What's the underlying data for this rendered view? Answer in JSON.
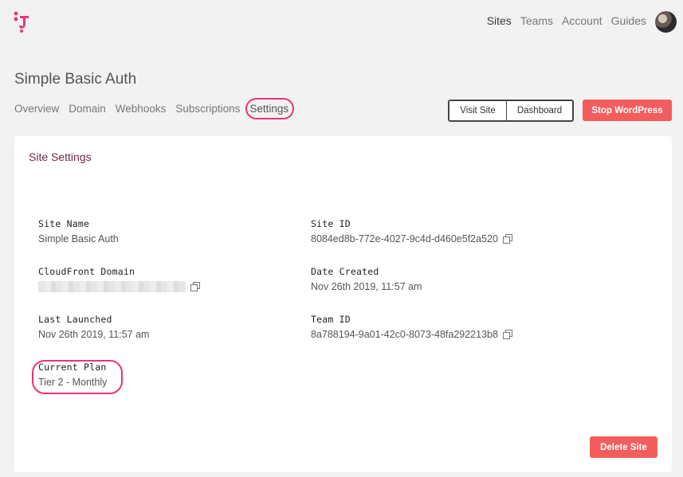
{
  "nav": {
    "items": [
      {
        "label": "Sites",
        "active": true
      },
      {
        "label": "Teams",
        "active": false
      },
      {
        "label": "Account",
        "active": false
      },
      {
        "label": "Guides",
        "active": false
      }
    ]
  },
  "page": {
    "title": "Simple Basic Auth"
  },
  "tabs": [
    {
      "label": "Overview",
      "active": false
    },
    {
      "label": "Domain",
      "active": false
    },
    {
      "label": "Webhooks",
      "active": false
    },
    {
      "label": "Subscriptions",
      "active": false
    },
    {
      "label": "Settings",
      "active": true
    }
  ],
  "actions": {
    "visit_site": "Visit Site",
    "dashboard": "Dashboard",
    "stop": "Stop WordPress",
    "delete": "Delete Site"
  },
  "settings": {
    "title": "Site Settings",
    "site_name": {
      "label": "Site Name",
      "value": "Simple Basic Auth"
    },
    "site_id": {
      "label": "Site ID",
      "value": "8084ed8b-772e-4027-9c4d-d460e5f2a520"
    },
    "cloudfront": {
      "label": "CloudFront Domain",
      "value": ""
    },
    "date_created": {
      "label": "Date Created",
      "value": "Nov 26th 2019, 11:57 am"
    },
    "last_launched": {
      "label": "Last Launched",
      "value": "Nov 26th 2019, 11:57 am"
    },
    "team_id": {
      "label": "Team ID",
      "value": "8a788194-9a01-42c0-8073-48fa292213b8"
    },
    "current_plan": {
      "label": "Current Plan",
      "value": "Tier 2 - Monthly"
    }
  },
  "colors": {
    "accent": "#e8347a",
    "danger_button": "#f45d5d",
    "card_title": "#6b2a4a",
    "background": "#f2f2f2"
  },
  "icons": {
    "logo": "brand-logo",
    "copy": "copy-icon",
    "avatar": "user-avatar"
  }
}
